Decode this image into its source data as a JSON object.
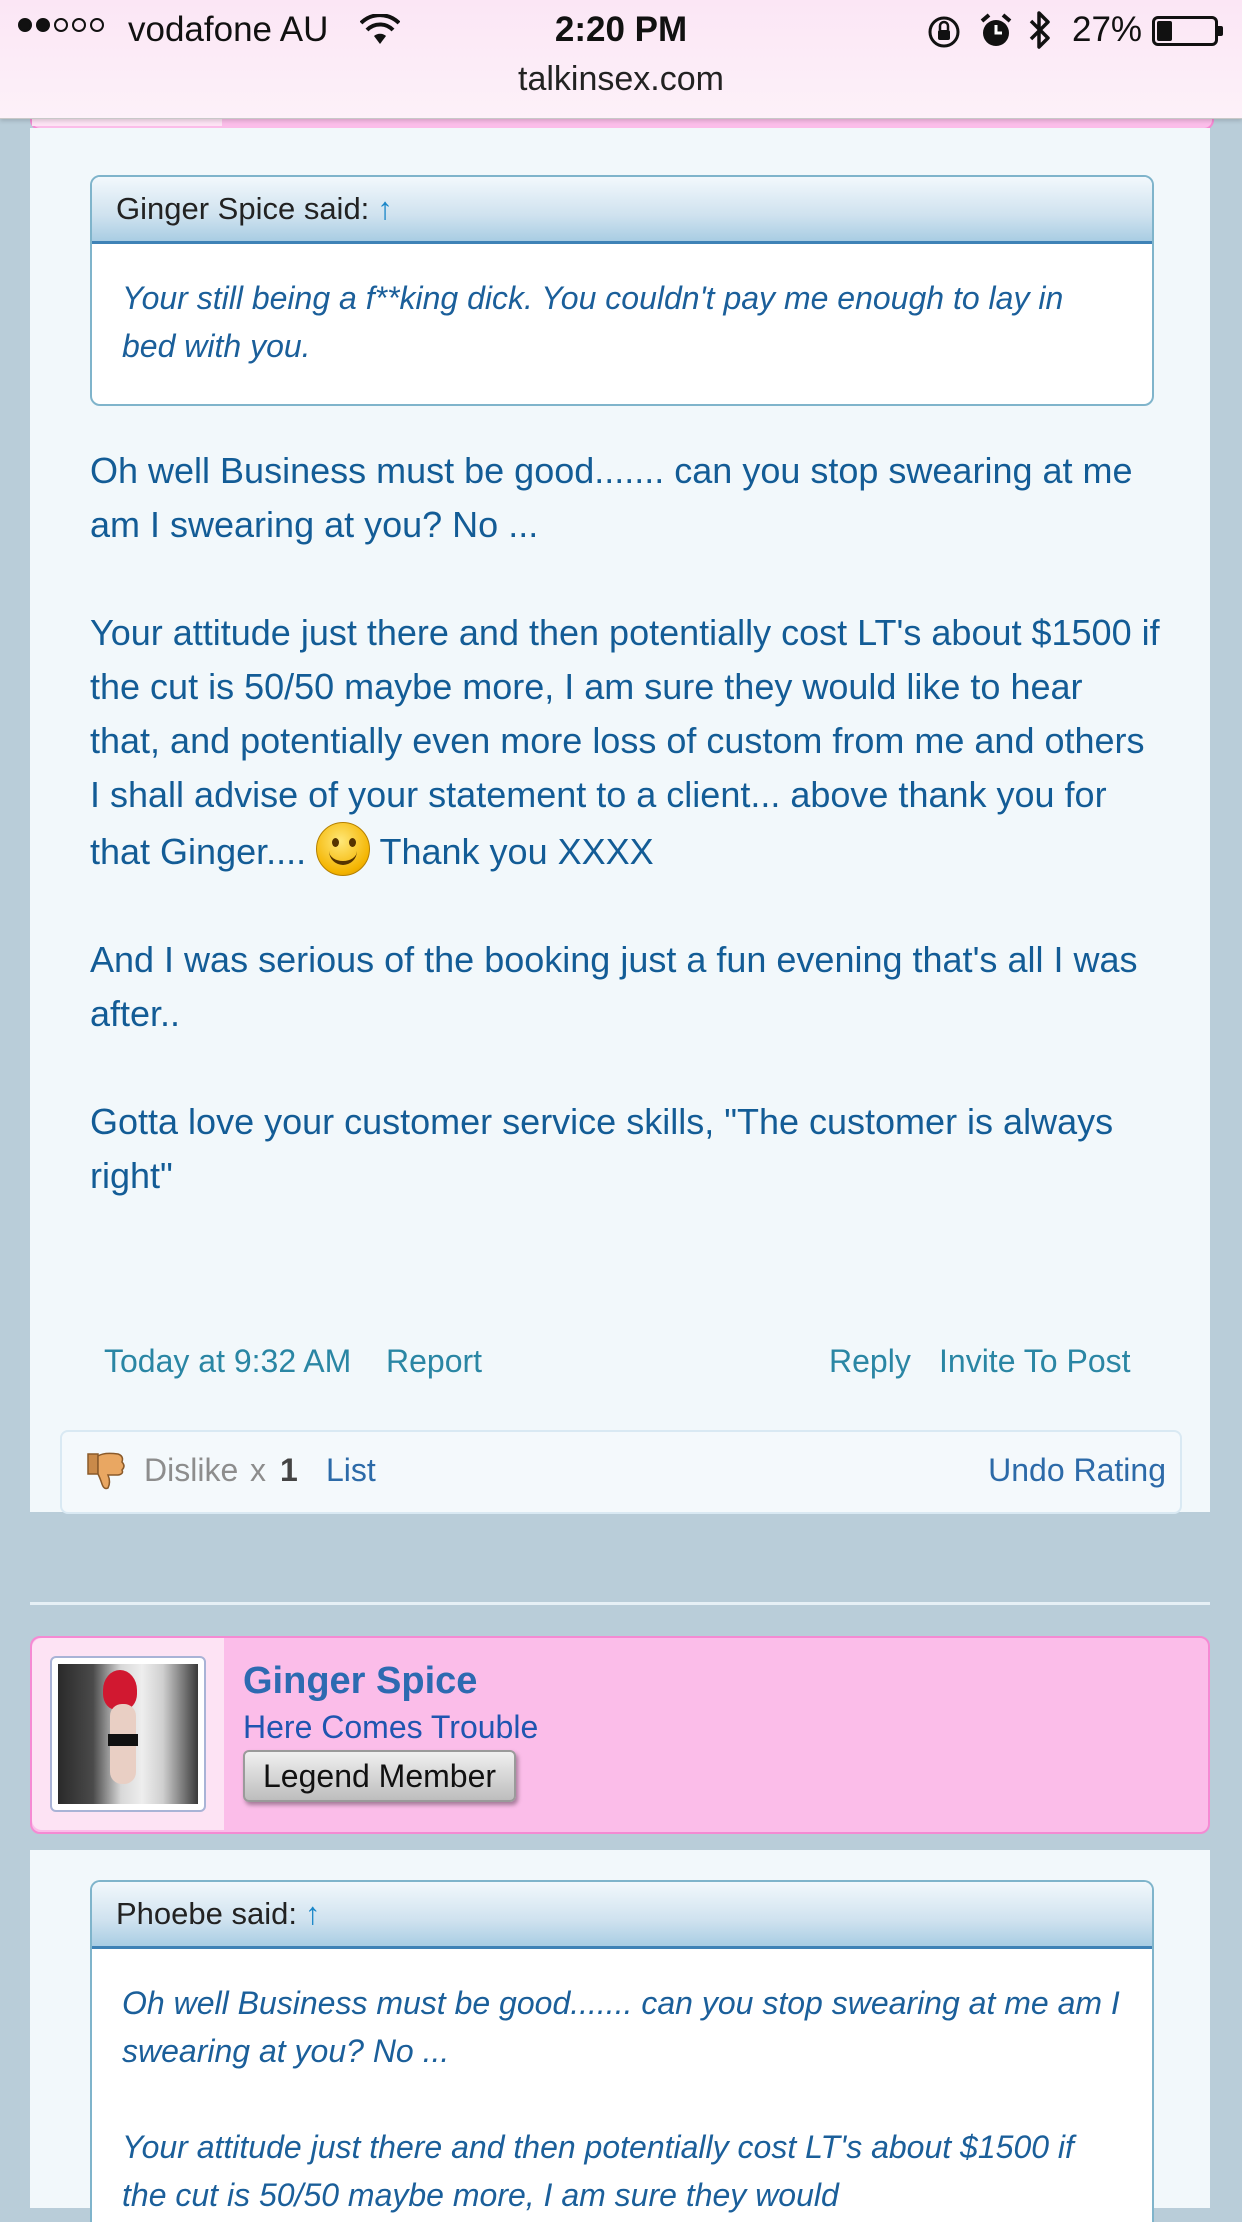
{
  "status_bar": {
    "signal_dots_filled": 2,
    "signal_dots_total": 5,
    "carrier": "vodafone AU",
    "time": "2:20 PM",
    "battery_percent": "27%",
    "battery_level": 0.27,
    "url": "talkinsex.com",
    "icons": [
      "wifi-icon",
      "orientation-lock-icon",
      "alarm-icon",
      "bluetooth-icon",
      "battery-icon"
    ]
  },
  "post1": {
    "quote": {
      "author_line": "Ginger Spice said:",
      "arrow": "↑",
      "text": "Your still being a f**king dick. You couldn't pay me enough to lay in bed with you."
    },
    "paragraphs": [
      "Oh well Business must be good....... can you stop swearing at me am I swearing at you? No ...",
      "Your attitude just there and then potentially cost LT's about $1500 if the cut is 50/50 maybe more, I am sure they would like to hear that, and potentially even more loss of custom from me and others I shall advise of your statement to a client... above thank you for that Ginger....",
      "Thank you XXXX",
      "And I was serious of the booking just a fun evening that's all I was after..",
      "Gotta love your customer service skills, \"The customer is always right\""
    ],
    "timestamp": "Today at 9:32 AM",
    "report": "Report",
    "reply": "Reply",
    "invite": "Invite To Post",
    "rating": {
      "label": "Dislike",
      "times": "x",
      "count": "1",
      "list": "List",
      "undo": "Undo Rating"
    }
  },
  "post2": {
    "username": "Ginger Spice",
    "user_title": "Here Comes Trouble",
    "rank": "Legend Member",
    "quote": {
      "author_line": "Phoebe said:",
      "arrow": "↑",
      "text1": "Oh well Business must be good....... can you stop swearing at me am I swearing at you? No ...",
      "text2": "Your attitude just there and then potentially cost LT's about $1500 if the cut is 50/50 maybe more, I am sure they would"
    }
  },
  "colors": {
    "page_bg": "#b9cdd9",
    "post_bg": "#f2f8fb",
    "text_blue": "#135c96",
    "link_teal": "#2a86a4",
    "profile_pink": "#fbbde9",
    "profile_border": "#f58ad3"
  }
}
